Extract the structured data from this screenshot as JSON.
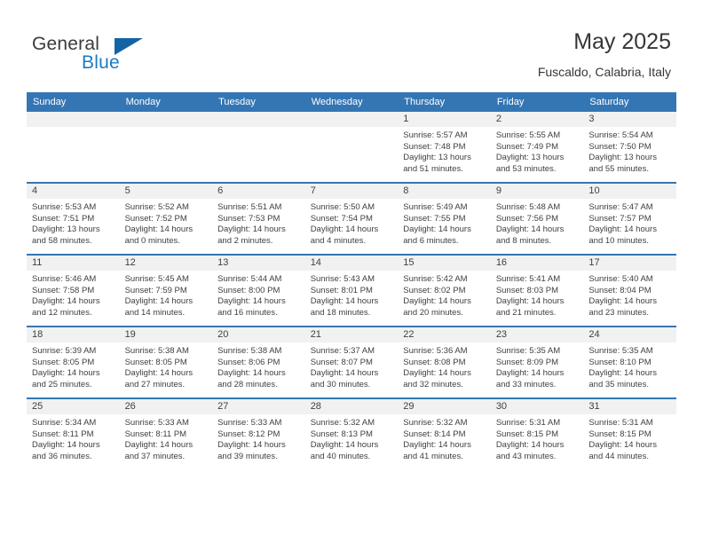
{
  "logo": {
    "word_primary": "General",
    "word_secondary": "Blue",
    "primary_color": "#3b3b3b",
    "secondary_color": "#1b7cc2",
    "triangle_color": "#1464a5"
  },
  "header": {
    "title": "May 2025",
    "subtitle": "Fuscaldo, Calabria, Italy"
  },
  "theme": {
    "header_row_bg": "#3476b4",
    "header_row_text": "#ffffff",
    "daynum_bar_bg": "#f1f1f1",
    "cell_bg": "#ffffff",
    "row_separator": "#3476b4",
    "body_text": "#3f3f3f"
  },
  "weekday_headers": [
    "Sunday",
    "Monday",
    "Tuesday",
    "Wednesday",
    "Thursday",
    "Friday",
    "Saturday"
  ],
  "weeks": [
    [
      {
        "day": "",
        "empty": true,
        "lines": []
      },
      {
        "day": "",
        "empty": true,
        "lines": []
      },
      {
        "day": "",
        "empty": true,
        "lines": []
      },
      {
        "day": "",
        "empty": true,
        "lines": []
      },
      {
        "day": "1",
        "empty": false,
        "lines": [
          "Sunrise: 5:57 AM",
          "Sunset: 7:48 PM",
          "Daylight: 13 hours",
          "and 51 minutes."
        ]
      },
      {
        "day": "2",
        "empty": false,
        "lines": [
          "Sunrise: 5:55 AM",
          "Sunset: 7:49 PM",
          "Daylight: 13 hours",
          "and 53 minutes."
        ]
      },
      {
        "day": "3",
        "empty": false,
        "lines": [
          "Sunrise: 5:54 AM",
          "Sunset: 7:50 PM",
          "Daylight: 13 hours",
          "and 55 minutes."
        ]
      }
    ],
    [
      {
        "day": "4",
        "empty": false,
        "lines": [
          "Sunrise: 5:53 AM",
          "Sunset: 7:51 PM",
          "Daylight: 13 hours",
          "and 58 minutes."
        ]
      },
      {
        "day": "5",
        "empty": false,
        "lines": [
          "Sunrise: 5:52 AM",
          "Sunset: 7:52 PM",
          "Daylight: 14 hours",
          "and 0 minutes."
        ]
      },
      {
        "day": "6",
        "empty": false,
        "lines": [
          "Sunrise: 5:51 AM",
          "Sunset: 7:53 PM",
          "Daylight: 14 hours",
          "and 2 minutes."
        ]
      },
      {
        "day": "7",
        "empty": false,
        "lines": [
          "Sunrise: 5:50 AM",
          "Sunset: 7:54 PM",
          "Daylight: 14 hours",
          "and 4 minutes."
        ]
      },
      {
        "day": "8",
        "empty": false,
        "lines": [
          "Sunrise: 5:49 AM",
          "Sunset: 7:55 PM",
          "Daylight: 14 hours",
          "and 6 minutes."
        ]
      },
      {
        "day": "9",
        "empty": false,
        "lines": [
          "Sunrise: 5:48 AM",
          "Sunset: 7:56 PM",
          "Daylight: 14 hours",
          "and 8 minutes."
        ]
      },
      {
        "day": "10",
        "empty": false,
        "lines": [
          "Sunrise: 5:47 AM",
          "Sunset: 7:57 PM",
          "Daylight: 14 hours",
          "and 10 minutes."
        ]
      }
    ],
    [
      {
        "day": "11",
        "empty": false,
        "lines": [
          "Sunrise: 5:46 AM",
          "Sunset: 7:58 PM",
          "Daylight: 14 hours",
          "and 12 minutes."
        ]
      },
      {
        "day": "12",
        "empty": false,
        "lines": [
          "Sunrise: 5:45 AM",
          "Sunset: 7:59 PM",
          "Daylight: 14 hours",
          "and 14 minutes."
        ]
      },
      {
        "day": "13",
        "empty": false,
        "lines": [
          "Sunrise: 5:44 AM",
          "Sunset: 8:00 PM",
          "Daylight: 14 hours",
          "and 16 minutes."
        ]
      },
      {
        "day": "14",
        "empty": false,
        "lines": [
          "Sunrise: 5:43 AM",
          "Sunset: 8:01 PM",
          "Daylight: 14 hours",
          "and 18 minutes."
        ]
      },
      {
        "day": "15",
        "empty": false,
        "lines": [
          "Sunrise: 5:42 AM",
          "Sunset: 8:02 PM",
          "Daylight: 14 hours",
          "and 20 minutes."
        ]
      },
      {
        "day": "16",
        "empty": false,
        "lines": [
          "Sunrise: 5:41 AM",
          "Sunset: 8:03 PM",
          "Daylight: 14 hours",
          "and 21 minutes."
        ]
      },
      {
        "day": "17",
        "empty": false,
        "lines": [
          "Sunrise: 5:40 AM",
          "Sunset: 8:04 PM",
          "Daylight: 14 hours",
          "and 23 minutes."
        ]
      }
    ],
    [
      {
        "day": "18",
        "empty": false,
        "lines": [
          "Sunrise: 5:39 AM",
          "Sunset: 8:05 PM",
          "Daylight: 14 hours",
          "and 25 minutes."
        ]
      },
      {
        "day": "19",
        "empty": false,
        "lines": [
          "Sunrise: 5:38 AM",
          "Sunset: 8:05 PM",
          "Daylight: 14 hours",
          "and 27 minutes."
        ]
      },
      {
        "day": "20",
        "empty": false,
        "lines": [
          "Sunrise: 5:38 AM",
          "Sunset: 8:06 PM",
          "Daylight: 14 hours",
          "and 28 minutes."
        ]
      },
      {
        "day": "21",
        "empty": false,
        "lines": [
          "Sunrise: 5:37 AM",
          "Sunset: 8:07 PM",
          "Daylight: 14 hours",
          "and 30 minutes."
        ]
      },
      {
        "day": "22",
        "empty": false,
        "lines": [
          "Sunrise: 5:36 AM",
          "Sunset: 8:08 PM",
          "Daylight: 14 hours",
          "and 32 minutes."
        ]
      },
      {
        "day": "23",
        "empty": false,
        "lines": [
          "Sunrise: 5:35 AM",
          "Sunset: 8:09 PM",
          "Daylight: 14 hours",
          "and 33 minutes."
        ]
      },
      {
        "day": "24",
        "empty": false,
        "lines": [
          "Sunrise: 5:35 AM",
          "Sunset: 8:10 PM",
          "Daylight: 14 hours",
          "and 35 minutes."
        ]
      }
    ],
    [
      {
        "day": "25",
        "empty": false,
        "lines": [
          "Sunrise: 5:34 AM",
          "Sunset: 8:11 PM",
          "Daylight: 14 hours",
          "and 36 minutes."
        ]
      },
      {
        "day": "26",
        "empty": false,
        "lines": [
          "Sunrise: 5:33 AM",
          "Sunset: 8:11 PM",
          "Daylight: 14 hours",
          "and 37 minutes."
        ]
      },
      {
        "day": "27",
        "empty": false,
        "lines": [
          "Sunrise: 5:33 AM",
          "Sunset: 8:12 PM",
          "Daylight: 14 hours",
          "and 39 minutes."
        ]
      },
      {
        "day": "28",
        "empty": false,
        "lines": [
          "Sunrise: 5:32 AM",
          "Sunset: 8:13 PM",
          "Daylight: 14 hours",
          "and 40 minutes."
        ]
      },
      {
        "day": "29",
        "empty": false,
        "lines": [
          "Sunrise: 5:32 AM",
          "Sunset: 8:14 PM",
          "Daylight: 14 hours",
          "and 41 minutes."
        ]
      },
      {
        "day": "30",
        "empty": false,
        "lines": [
          "Sunrise: 5:31 AM",
          "Sunset: 8:15 PM",
          "Daylight: 14 hours",
          "and 43 minutes."
        ]
      },
      {
        "day": "31",
        "empty": false,
        "lines": [
          "Sunrise: 5:31 AM",
          "Sunset: 8:15 PM",
          "Daylight: 14 hours",
          "and 44 minutes."
        ]
      }
    ]
  ]
}
